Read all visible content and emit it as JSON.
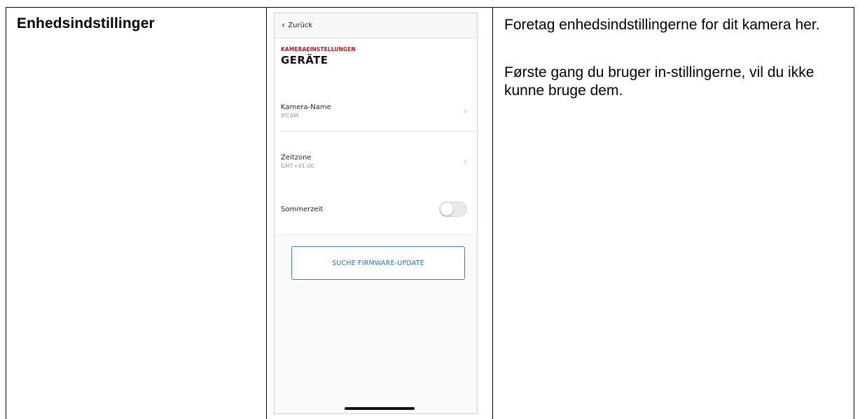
{
  "left_cell": {
    "title": "Enhedsindstillinger"
  },
  "right_cell": {
    "paragraph_1": "Foretag enhedsindstillingerne for dit kamera her.",
    "paragraph_2": "Første gang du bruger in-stillingerne, vil du ikke kunne bruge dem."
  },
  "phone": {
    "back_label": "Zurück",
    "back_icon": "chevron-left-icon",
    "eyebrow": "KAMERAEINSTELLUNGEN",
    "title": "GERÄTE",
    "rows": [
      {
        "label": "Kamera-Name",
        "value": "IPCAM",
        "icon": "chevron-right-icon"
      },
      {
        "label": "Zeitzone",
        "value": "GMT+01:00",
        "icon": "chevron-right-icon"
      },
      {
        "label": "Sommerzeit",
        "toggle_on": false
      }
    ],
    "firmware_button": "SUCHE FIRMWARE-UPDATE",
    "colors": {
      "accent_red": "#c4111c",
      "button_blue": "#2a6cc9"
    }
  }
}
